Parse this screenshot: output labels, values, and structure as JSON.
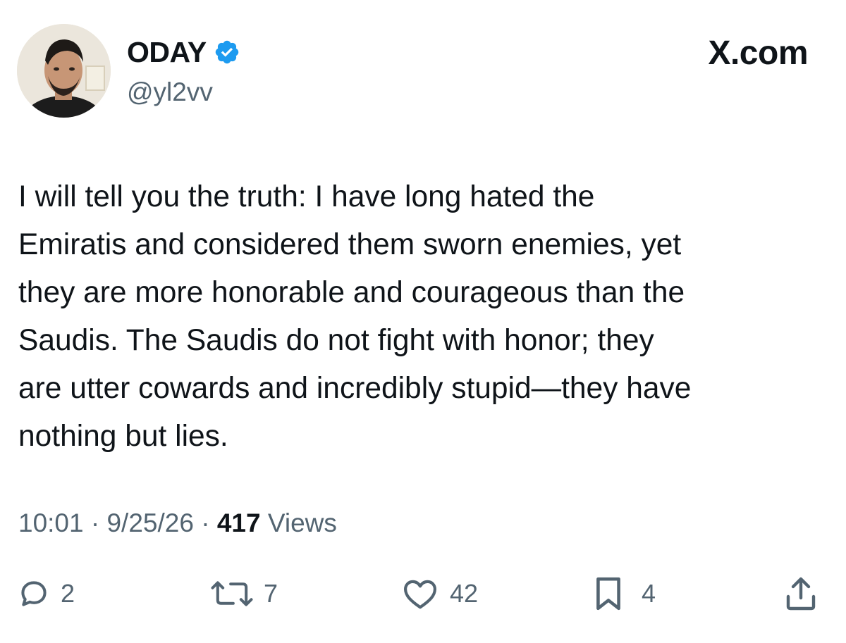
{
  "brand": "X.com",
  "author": {
    "name": "ODAY",
    "handle": "@yl2vv",
    "avatar_icon": "profile-photo",
    "verified_icon": "verified-badge-icon",
    "verified_color": "#1d9bf0"
  },
  "tweet": {
    "text": "I will tell you the truth: I have long hated the\nEmiratis and considered them sworn enemies, yet\nthey are more honorable and courageous than the\nSaudis. The Saudis do not fight with honor; they\nare utter cowards and incredibly stupid—they have\nnothing but lies."
  },
  "meta": {
    "time": "10:01",
    "date": "9/25/26",
    "separator": "·",
    "views_count": "417",
    "views_label": "Views"
  },
  "actions": {
    "reply": {
      "icon": "reply-icon",
      "count": "2"
    },
    "repost": {
      "icon": "repost-icon",
      "count": "7"
    },
    "like": {
      "icon": "heart-icon",
      "count": "42"
    },
    "bookmark": {
      "icon": "bookmark-icon",
      "count": "4"
    },
    "share": {
      "icon": "share-icon"
    }
  },
  "colors": {
    "text": "#0f1419",
    "secondary": "#536471",
    "accent": "#1d9bf0",
    "background": "#ffffff"
  }
}
